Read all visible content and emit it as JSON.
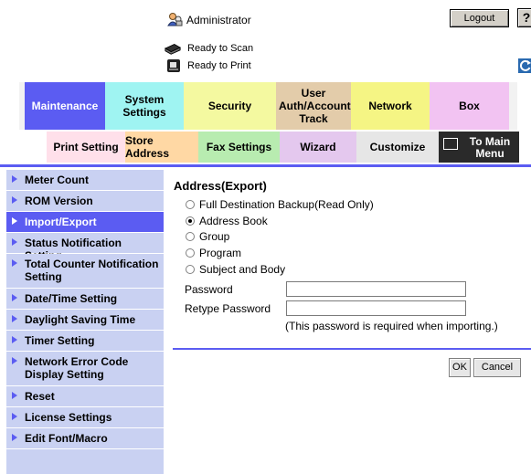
{
  "header": {
    "user_name": "Administrator",
    "logout_label": "Logout",
    "help_label": "?",
    "status_scan": "Ready to Scan",
    "status_print": "Ready to Print",
    "admin_icon": "admin-user-icon",
    "scan_icon": "scanner-icon",
    "print_icon": "printer-icon",
    "refresh_icon": "refresh-icon"
  },
  "main_tabs": [
    {
      "label": "Maintenance",
      "active": true
    },
    {
      "label": "System Settings"
    },
    {
      "label": "Security"
    },
    {
      "label": "User Auth/Account Track"
    },
    {
      "label": "Network"
    },
    {
      "label": "Box"
    }
  ],
  "sub_tabs": [
    {
      "label": "Print Setting"
    },
    {
      "label": "Store Address"
    },
    {
      "label": "Fax Settings"
    },
    {
      "label": "Wizard"
    },
    {
      "label": "Customize"
    },
    {
      "label": "To Main Menu"
    }
  ],
  "sidebar": {
    "items": [
      {
        "label": "Meter Count"
      },
      {
        "label": "ROM Version"
      },
      {
        "label": "Import/Export",
        "active": true
      },
      {
        "label": "Status Notification Setting"
      },
      {
        "label": "Total Counter Notification Setting"
      },
      {
        "label": "Date/Time Setting"
      },
      {
        "label": "Daylight Saving Time"
      },
      {
        "label": "Timer Setting"
      },
      {
        "label": "Network Error Code Display Setting"
      },
      {
        "label": "Reset"
      },
      {
        "label": "License Settings"
      },
      {
        "label": "Edit Font/Macro"
      }
    ]
  },
  "content": {
    "title": "Address(Export)",
    "options": [
      {
        "label": "Full Destination Backup(Read Only)",
        "checked": false
      },
      {
        "label": "Address Book",
        "checked": true
      },
      {
        "label": "Group",
        "checked": false
      },
      {
        "label": "Program",
        "checked": false
      },
      {
        "label": "Subject and Body",
        "checked": false
      }
    ],
    "password_label": "Password",
    "password_value": "",
    "retype_label": "Retype Password",
    "retype_value": "",
    "note": "(This password is required when importing.)",
    "ok_label": "OK",
    "cancel_label": "Cancel"
  },
  "colors": {
    "accent": "#5b5cf2",
    "sidebar_bg": "#c9d1f2"
  }
}
